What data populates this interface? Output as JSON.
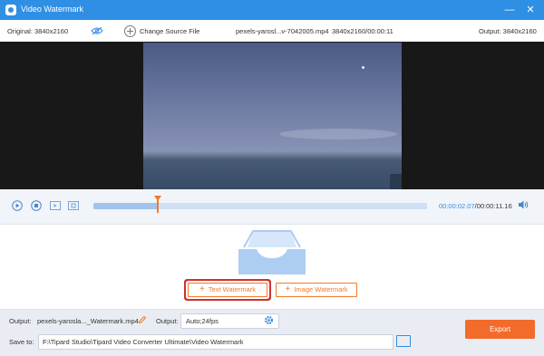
{
  "window": {
    "title": "Video Watermark"
  },
  "info_bar": {
    "original": "Original: 3840x2160",
    "change_source": "Change Source File",
    "filename": "pexels-yarosl...v-7042005.mp4",
    "resolution_duration": "3840x2160/00:00:11",
    "output": "Output: 3840x2160"
  },
  "player": {
    "current_time": "00:00:02.07",
    "total_time": "/00:00:11.16"
  },
  "watermark": {
    "text_button": "Text Watermark",
    "image_button": "Image Watermark"
  },
  "bottom": {
    "output_label": "Output:",
    "output_file": "pexels-yarosla..._Watermark.mp4",
    "format_label": "Output:",
    "format_value": "Auto;24fps",
    "save_label": "Save to:",
    "save_path": "F:\\Tipard Studio\\Tipard Video Converter Ultimate\\Video Watermark",
    "more": "···",
    "export_button": "Export"
  },
  "colors": {
    "titlebar": "#2f8fe5",
    "accent": "#f07b2a",
    "highlight": "#d03030"
  },
  "icons": [
    "app-logo-icon",
    "minimize-icon",
    "close-icon",
    "eye-off-icon",
    "add-circle-icon",
    "play-icon",
    "stop-icon",
    "clip-start-icon",
    "clip-end-icon",
    "volume-icon",
    "edit-pencil-icon",
    "gear-icon",
    "folder-icon",
    "inbox-tray-icon",
    "plus-icon"
  ]
}
